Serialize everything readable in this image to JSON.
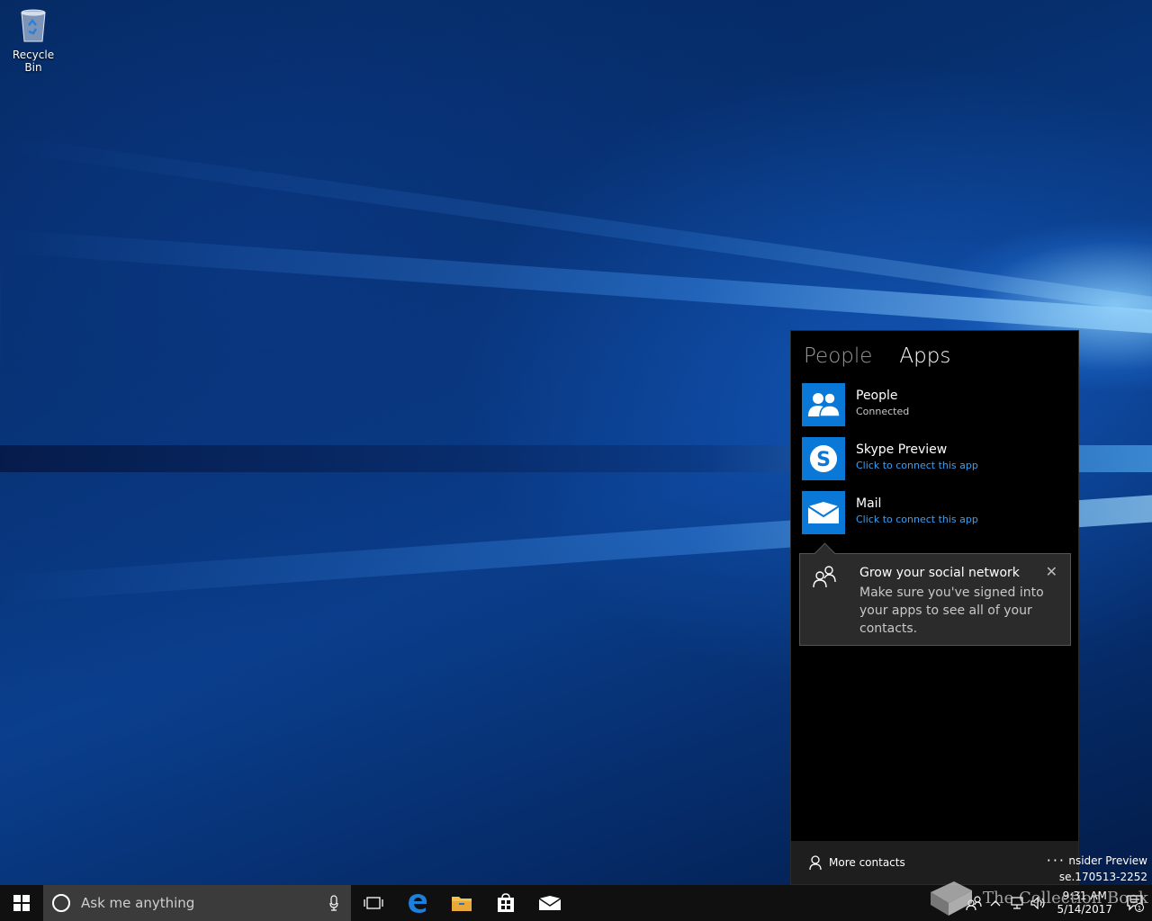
{
  "desktop": {
    "recycle_bin_label": "Recycle Bin"
  },
  "flyout": {
    "tabs": [
      {
        "label": "People",
        "active": false
      },
      {
        "label": "Apps",
        "active": true
      }
    ],
    "apps": [
      {
        "name": "People",
        "status": "Connected",
        "icon": "people-app-icon"
      },
      {
        "name": "Skype Preview",
        "status": "Click to connect this app",
        "icon": "skype-icon"
      },
      {
        "name": "Mail",
        "status": "Click to connect this app",
        "icon": "mail-icon"
      }
    ],
    "tip": {
      "title": "Grow your social network",
      "body": "Make sure you've signed into your apps to see all of your contacts.",
      "close": "✕"
    },
    "footer": {
      "more_contacts": "More contacts",
      "more_options": "···"
    },
    "accent_color": "#0a78d7",
    "link_color": "#3c9ff0"
  },
  "watermark": {
    "line1": "nsider Preview",
    "line2": "se.170513-2252"
  },
  "taskbar": {
    "search_placeholder": "Ask me anything",
    "clock_time": "9:31 AM",
    "clock_date": "5/14/2017",
    "notification_count": "1",
    "brand_watermark": "The Collection Book"
  }
}
